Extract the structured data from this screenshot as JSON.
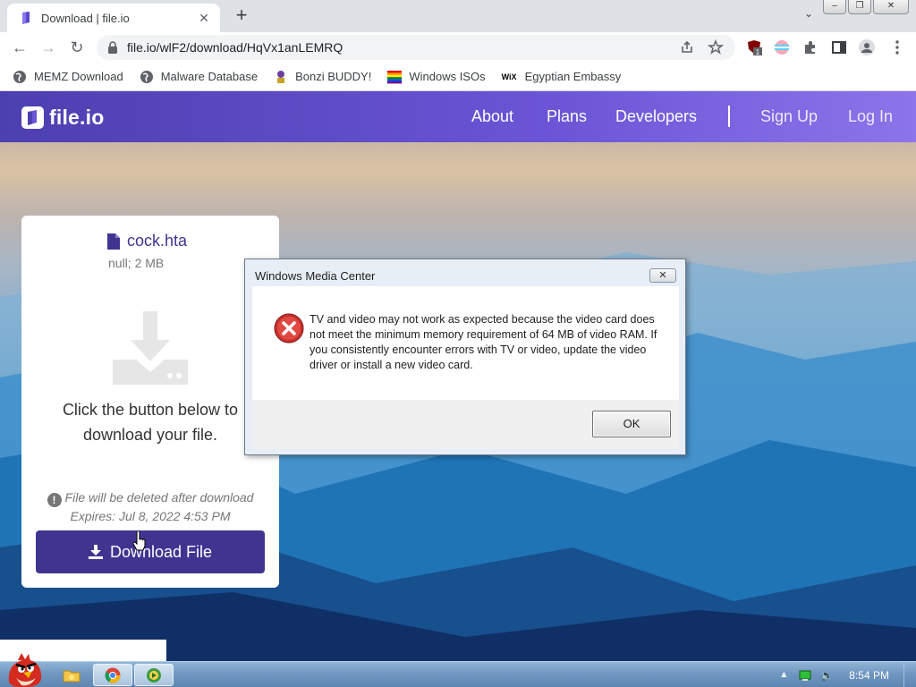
{
  "browser": {
    "tab": {
      "title": "Download | file.io",
      "close": "✕"
    },
    "new_tab": "+",
    "tab_search": "⌄",
    "window_controls": {
      "minimize": "‒",
      "maximize": "❐",
      "close": "✕"
    },
    "nav": {
      "back": "←",
      "forward": "→",
      "reload": "↻"
    },
    "url": "file.io/wlF2/download/HqVx1anLEMRQ",
    "extension_badge": "1",
    "bookmarks": [
      {
        "label": "MEMZ Download",
        "icon": "globe-icon"
      },
      {
        "label": "Malware Database",
        "icon": "globe-icon"
      },
      {
        "label": "Bonzi BUDDY!",
        "icon": "bonzi-icon"
      },
      {
        "label": "Windows ISOs",
        "icon": "rainbow-flag-icon"
      },
      {
        "label": "Egyptian Embassy",
        "icon": "wix-icon"
      }
    ],
    "wix_label": "WiX"
  },
  "site": {
    "logo": "file.io",
    "nav": {
      "about": "About",
      "plans": "Plans",
      "developers": "Developers",
      "sign_up": "Sign Up",
      "log_in": "Log In"
    },
    "accent": "#3f3591"
  },
  "card": {
    "file_name": "cock.hta",
    "file_meta": "null; 2 MB",
    "instructions": "Click the button below to download your file.",
    "warning_icon": "!",
    "warning": "File will be deleted after download",
    "expires": "Expires: Jul 8, 2022 4:53 PM",
    "download_label": "Download File"
  },
  "dialog": {
    "title": "Windows Media Center",
    "close": "✕",
    "message": "TV and video may not work as expected because the video card does not meet the minimum memory requirement of 64 MB of video RAM. If you consistently encounter errors with TV or video, update the video driver or install a new video card.",
    "ok_label": "OK"
  },
  "taskbar": {
    "clock": "8:54 PM",
    "tray_expand": "▲",
    "volume_icon": "🔈"
  }
}
